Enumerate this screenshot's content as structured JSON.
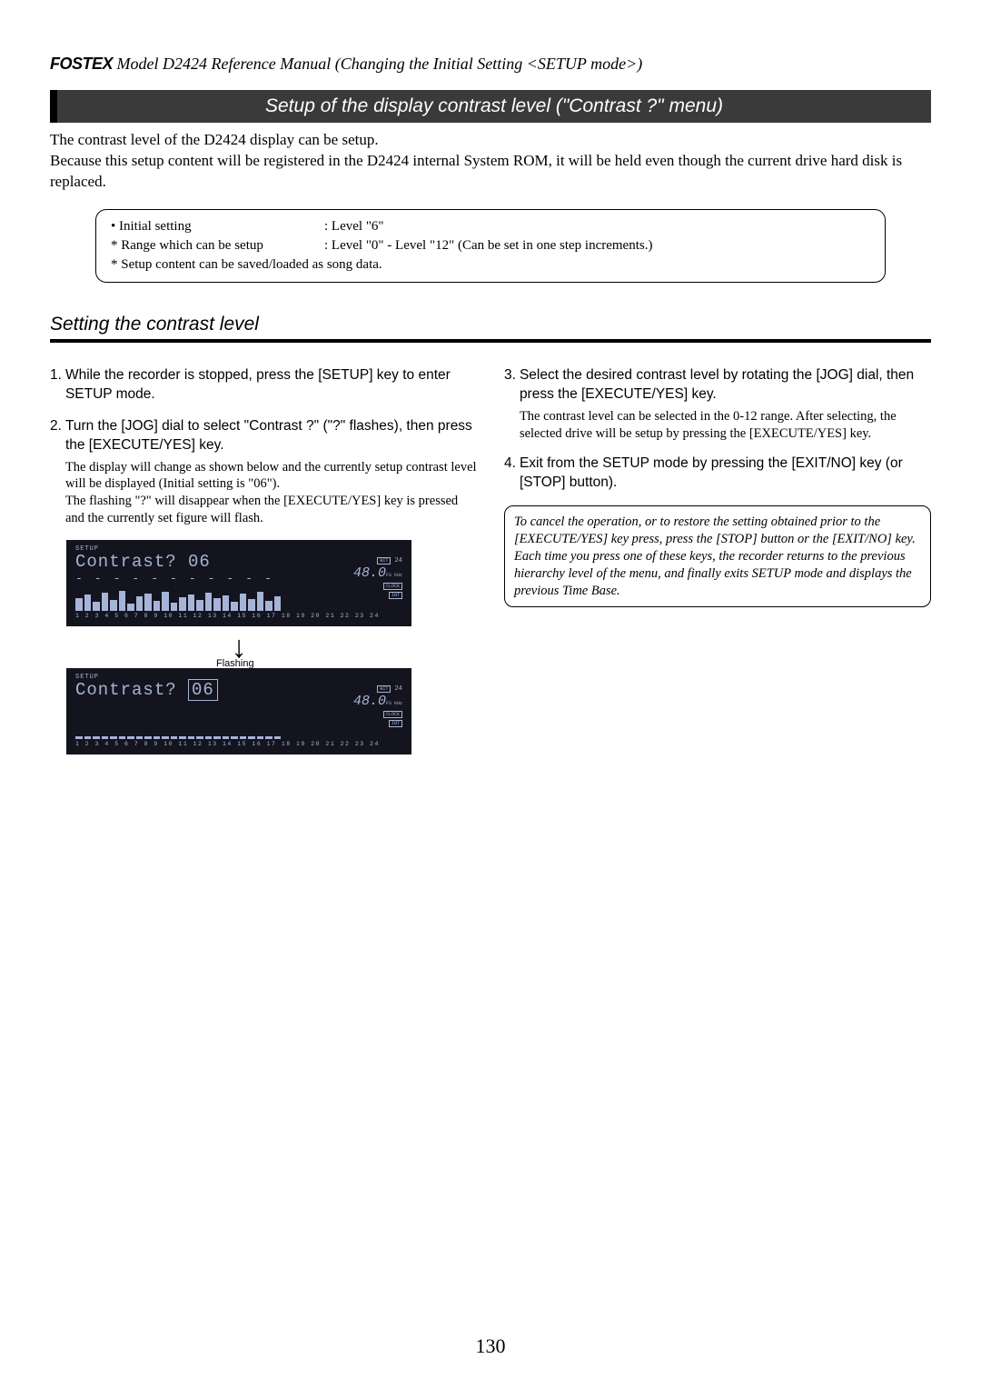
{
  "header": {
    "brand": "FOSTEX",
    "text": " Model D2424  Reference Manual (Changing the Initial Setting <SETUP mode>)"
  },
  "title": "Setup of the display contrast level (\"Contrast ?\" menu)",
  "intro": "The contrast level of the D2424 display can be setup.\nBecause this setup content will be registered in the D2424 internal System ROM, it will be held even though the current drive hard disk is replaced.",
  "info": {
    "row1_label": "• Initial setting",
    "row1_value": ": Level \"6\"",
    "row2_label": "* Range which can be setup",
    "row2_value": ": Level \"0\" - Level \"12\" (Can be set in one step increments.)",
    "row3": "* Setup content can be saved/loaded as song data."
  },
  "subheading": "Setting the contrast level",
  "left": {
    "step1_num": "1.",
    "step1": "While the recorder is stopped, press the [SETUP] key to enter SETUP mode.",
    "step2_num": "2.",
    "step2": "Turn the [JOG] dial to select \"Contrast ?\" (\"?\" flashes), then press the [EXECUTE/YES] key.",
    "step2_detail": "The display will change as shown below and the currently setup contrast level will be displayed (Initial setting is \"06\").\nThe flashing \"?\" will disappear when the [EXECUTE/YES] key is pressed and the currently set figure will flash."
  },
  "right": {
    "step3_num": "3.",
    "step3": "Select the desired contrast level by rotating the [JOG] dial, then press the [EXECUTE/YES] key.",
    "step3_detail": "The contrast level can be selected in the 0-12 range. After selecting, the selected drive will be setup by pressing the [EXECUTE/YES] key.",
    "step4_num": "4.",
    "step4": " Exit from the SETUP mode by pressing the [EXIT/NO] key (or [STOP] button).",
    "note": "To cancel the operation, or to restore the setting obtained prior to the [EXECUTE/YES] key press, press the [STOP] button or the [EXIT/NO] key.  Each time you press one of these keys, the recorder returns to the previous hierarchy level of the menu, and finally exits SETUP mode and displays the previous Time Base."
  },
  "display": {
    "setup_label": "SETUP",
    "line1_a": "Contrast? 06",
    "line1_b_pre": "Contrast? ",
    "line1_b_val": "06",
    "dashes": "- - - - - - - - - - -",
    "tracks": "1  2  3  4  5  6  7  8  9 10 11 12 13 14 15 16 17 18 19 20 21 22 23 24",
    "bit": "BIT",
    "bit_val": "24",
    "khz": "48.0",
    "khz_unit": "FS kHz",
    "clock": "CLOCK",
    "int": "INT",
    "flashing": "Flashing"
  },
  "pagenum": "130"
}
